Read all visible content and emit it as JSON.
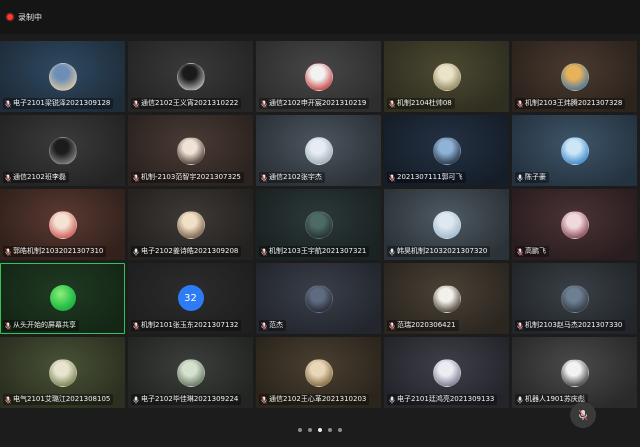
{
  "recording": {
    "label": "录制中"
  },
  "tiles": [
    {
      "name": "电子2101梁锐泽2021309128",
      "bg": [
        "#2e4a63",
        "#1f2d3a"
      ],
      "avatar": [
        "#6d8fb6",
        "#e0c7a3"
      ],
      "kind": "photo",
      "muted": true
    },
    {
      "name": "通信2102王义宵2021310222",
      "bg": [
        "#3a3a3a",
        "#252525"
      ],
      "avatar": [
        "#1a1a1a",
        "#bdbdbd"
      ],
      "kind": "photo",
      "muted": true
    },
    {
      "name": "通信2102申开宸2021310219",
      "bg": [
        "#474747",
        "#2e2e2e"
      ],
      "avatar": [
        "#f2f2f2",
        "#c03434"
      ],
      "kind": "photo",
      "muted": true
    },
    {
      "name": "机制2104杜帅08",
      "bg": [
        "#4c4a32",
        "#2f2e20"
      ],
      "avatar": [
        "#e9e3c8",
        "#8a7d55"
      ],
      "kind": "photo",
      "muted": true
    },
    {
      "name": "机制2103王炜腾2021307328",
      "bg": [
        "#4a3a2f",
        "#2c231d"
      ],
      "avatar": [
        "#e6b25a",
        "#3a6ea8"
      ],
      "kind": "photo",
      "muted": true
    },
    {
      "name": "通信2102班李磊",
      "bg": [
        "#3b3b3b",
        "#242424"
      ],
      "avatar": [
        "#1c1c1c",
        "#8a8a8a"
      ],
      "kind": "photo",
      "muted": true
    },
    {
      "name": "机制-2103范智宇2021307325",
      "bg": [
        "#4a3b35",
        "#2b2320"
      ],
      "avatar": [
        "#f0e2d4",
        "#3a2d26"
      ],
      "kind": "photo",
      "muted": true
    },
    {
      "name": "通信2102张宇杰",
      "bg": [
        "#4c5660",
        "#2b3137"
      ],
      "avatar": [
        "#e6ecf2",
        "#9aa6b0"
      ],
      "kind": "photo",
      "muted": true
    },
    {
      "name": "2021307111郭可飞",
      "bg": [
        "#243244",
        "#151d28"
      ],
      "avatar": [
        "#8fb2d6",
        "#1c2a3a"
      ],
      "kind": "photo",
      "muted": true
    },
    {
      "name": "陈子豪",
      "bg": [
        "#3e5568",
        "#253341"
      ],
      "avatar": [
        "#cde6f6",
        "#2f7fc4"
      ],
      "kind": "photo",
      "muted": false
    },
    {
      "name": "郭皓机制21032021307310",
      "bg": [
        "#5a3a32",
        "#33211c"
      ],
      "avatar": [
        "#f4e2d2",
        "#c94b4b"
      ],
      "kind": "photo",
      "muted": true
    },
    {
      "name": "电子2102姜诗皓2021309208",
      "bg": [
        "#3e3a36",
        "#24211f"
      ],
      "avatar": [
        "#f1e0c6",
        "#6b5440"
      ],
      "kind": "photo",
      "muted": false
    },
    {
      "name": "机制2103王宇航2021307321",
      "bg": [
        "#2c3838",
        "#1a2222"
      ],
      "avatar": [
        "#4e6a66",
        "#1d2a29"
      ],
      "kind": "photo",
      "muted": true
    },
    {
      "name": "韩昊机制21032021307320",
      "bg": [
        "#4f5a63",
        "#2c3338"
      ],
      "avatar": [
        "#dfe8f0",
        "#9ab4c9"
      ],
      "kind": "photo",
      "muted": false
    },
    {
      "name": "高鹏飞",
      "bg": [
        "#4a3336",
        "#2a1d1f"
      ],
      "avatar": [
        "#f1d8dc",
        "#7d3b44"
      ],
      "kind": "photo",
      "muted": true
    },
    {
      "name": "从头开始的屏幕共享",
      "bg": [
        "#1f3a22",
        "#142616"
      ],
      "avatar": [
        "#2cc34c",
        "#1a8f34"
      ],
      "kind": "green",
      "muted": true,
      "active": true
    },
    {
      "name": "机制2101张玉东2021307132",
      "bg": [
        "#2c2c2c",
        "#1f1f1f"
      ],
      "avatar": [
        "#2d7cf6",
        "#2d7cf6"
      ],
      "kind": "num",
      "numText": "32",
      "muted": true
    },
    {
      "name": "范杰",
      "bg": [
        "#3a3f4a",
        "#23262d"
      ],
      "avatar": [
        "#5f6b80",
        "#1e232c"
      ],
      "kind": "photo",
      "muted": true
    },
    {
      "name": "范瑞2020306421",
      "bg": [
        "#4a4236",
        "#2b2620"
      ],
      "avatar": [
        "#f2f0ea",
        "#3c3326"
      ],
      "kind": "photo",
      "muted": true
    },
    {
      "name": "机制2103赵马杰2021307330",
      "bg": [
        "#3a4046",
        "#22262a"
      ],
      "avatar": [
        "#6d7f91",
        "#2a3138"
      ],
      "kind": "photo",
      "muted": true
    },
    {
      "name": "电气2101艾璐江2021308105",
      "bg": [
        "#495236",
        "#2b3020"
      ],
      "avatar": [
        "#e8e4cf",
        "#6e7a48"
      ],
      "kind": "photo",
      "muted": true
    },
    {
      "name": "电子2102毕佳琳2021309224",
      "bg": [
        "#3d3f3d",
        "#232523"
      ],
      "avatar": [
        "#d6e2d0",
        "#5c6b55"
      ],
      "kind": "photo",
      "muted": false
    },
    {
      "name": "通信2102王心革2021310203",
      "bg": [
        "#4a4031",
        "#2b251c"
      ],
      "avatar": [
        "#e8d8b8",
        "#7a5f36"
      ],
      "kind": "photo",
      "muted": true
    },
    {
      "name": "电子2101廷鸿亮2021309133",
      "bg": [
        "#3e3f49",
        "#24252b"
      ],
      "avatar": [
        "#ecedf3",
        "#6e7185"
      ],
      "kind": "photo",
      "muted": false
    },
    {
      "name": "机器人1901苏庆彪",
      "bg": [
        "#4a4a4a",
        "#2a2a2a"
      ],
      "avatar": [
        "#f2f2f2",
        "#333333"
      ],
      "kind": "photo",
      "muted": false
    }
  ],
  "pagination": {
    "count": 5,
    "active": 2
  },
  "colors": {
    "accent": "#36c25a",
    "record": "#ff3b30",
    "avatarNumber": "#2d7cf6"
  }
}
